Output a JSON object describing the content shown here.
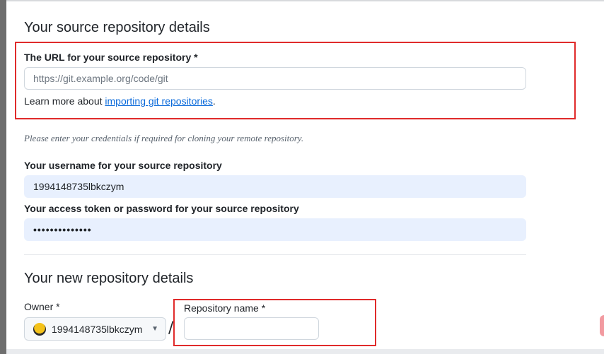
{
  "source": {
    "heading": "Your source repository details",
    "url_label": "The URL for your source repository *",
    "url_placeholder": "https://git.example.org/code/git",
    "learn_prefix": "Learn more about ",
    "learn_link": "importing git repositories",
    "learn_suffix": ".",
    "credentials_hint": "Please enter your credentials if required for cloning your remote repository.",
    "username_label": "Your username for your source repository",
    "username_value": "1994148735lbkczym",
    "password_label": "Your access token or password for your source repository",
    "password_value": "••••••••••••••"
  },
  "new_repo": {
    "heading": "Your new repository details",
    "owner_label": "Owner *",
    "owner_value": "1994148735lbkczym",
    "repo_name_label": "Repository name *",
    "repo_name_value": "",
    "separator": "/"
  },
  "icons": {
    "avatar": "user-avatar-icon",
    "caret": "triangle-down-icon"
  },
  "colors": {
    "highlight_border": "#e02b2b",
    "link": "#0969da",
    "autofill_bg": "#e8f0fe"
  }
}
